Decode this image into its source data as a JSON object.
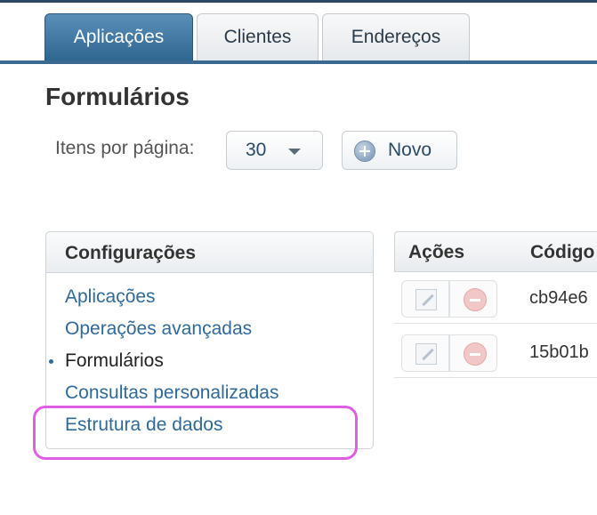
{
  "tabs": [
    {
      "label": "Aplicações",
      "active": true
    },
    {
      "label": "Clientes",
      "active": false
    },
    {
      "label": "Endereços",
      "active": false
    }
  ],
  "page_title": "Formulários",
  "pagination": {
    "label": "Itens por página:",
    "selected": "30"
  },
  "new_button": {
    "label": "Novo",
    "icon": "plus-circle-icon"
  },
  "config_panel": {
    "title": "Configurações",
    "items": [
      {
        "label": "Aplicações"
      },
      {
        "label": "Operações avançadas"
      },
      {
        "label": "Formulários",
        "current": true
      },
      {
        "label": "Consultas personalizadas"
      },
      {
        "label": "Estrutura de dados",
        "highlighted": true
      }
    ]
  },
  "table": {
    "columns": [
      "Ações",
      "Código"
    ],
    "rows": [
      {
        "code": "cb94e6"
      },
      {
        "code": "15b01b"
      }
    ]
  },
  "colors": {
    "active_tab": "#2f6690",
    "link": "#2f6a9a",
    "highlight": "#e05ee6"
  }
}
